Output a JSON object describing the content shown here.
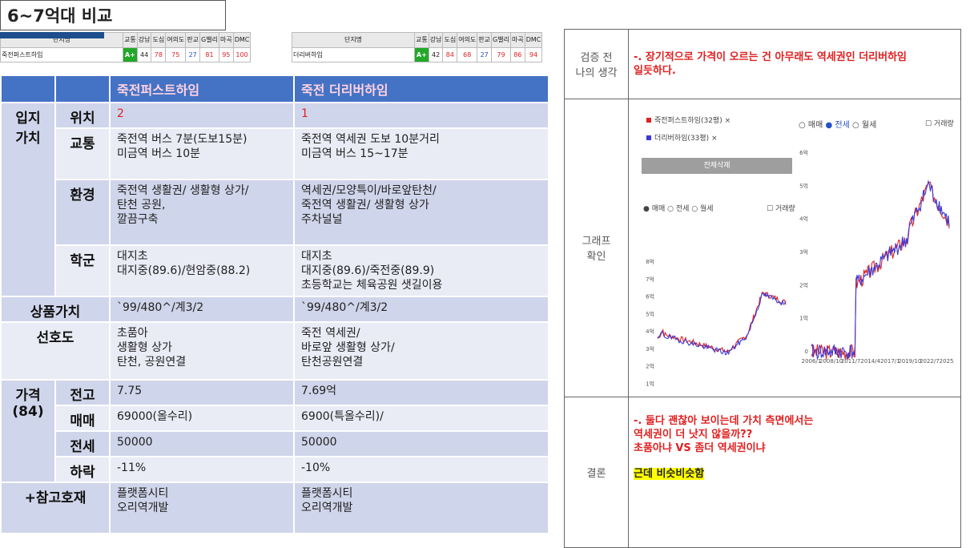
{
  "page_title": "6~7억대 비교",
  "strip": {
    "headers": [
      "단지명",
      "교통",
      "강남",
      "도심",
      "여의도",
      "판교",
      "G밸리",
      "마곡",
      "DMC"
    ],
    "left": {
      "name": "죽전퍼스트하임",
      "grade": "A+",
      "nums": [
        "44",
        "78",
        "75",
        "27",
        "81",
        "95",
        "100"
      ]
    },
    "right": {
      "name": "더리버하임",
      "grade": "A+",
      "nums": [
        "42",
        "84",
        "68",
        "27",
        "79",
        "86",
        "94"
      ]
    }
  },
  "table": {
    "col1": "죽전퍼스트하임",
    "col2": "죽전 더리버하임",
    "rows": {
      "location_cat": "입지\n가치",
      "pos_label": "위치",
      "pos_1": "2",
      "pos_2": "1",
      "traffic_label": "교통",
      "traffic_1": "죽전역 버스 7분(도보15분)\n미금역 버스 10분",
      "traffic_2": "죽전역 역세권 도보 10분거리\n미금역 버스 15~17분",
      "env_label": "환경",
      "env_1": "죽전역 생활권/ 생활형 상가/\n탄천 공원,\n깔끔구축",
      "env_2": "역세권/모양특이/바로앞탄천/\n죽전역 생활권/ 생활형 상가\n주차널널",
      "school_label": "학군",
      "school_1": "대지초\n대지중(89.6)/현암중(88.2)",
      "school_2": "대지초\n대지중(89.6)/죽전중(89.9)\n초등학교는 체육공원 샛길이용",
      "product_label": "상품가치",
      "product_1": "`99/480^/계3/2",
      "product_2": "`99/480^/계3/2",
      "pref_label": "선호도",
      "pref_1": "초품아\n생활형 상가\n탄천, 공원연결",
      "pref_2": "죽전 역세권/\n바로앞 생활형 상가/\n탄천공원연결",
      "price_cat": "가격\n(84)",
      "peak_label": "전고",
      "peak_1": "7.75",
      "peak_2": "7.69억",
      "sale_label": "매매",
      "sale_1": "69000(올수리)",
      "sale_2": "6900(특올수리)/",
      "jeonse_label": "전세",
      "jeonse_1": "50000",
      "jeonse_2": "50000",
      "drop_label": "하락",
      "drop_1": "-11%",
      "drop_2": "-10%",
      "ref_label": "+참고호재",
      "ref_1": "플랫폼시티\n오리역개발",
      "ref_2": "플랫폼시티\n오리역개발"
    }
  },
  "right": {
    "verify_label": "검증 전\n나의 생각",
    "verify_text": "-. 장기적으로 가격이 오르는 건 아무래도 역세권인 더리버하임\n일듯하다.",
    "graph_label": "그래프\n확인",
    "conclusion_label": "결론",
    "conclusion_text": "-. 둘다 괜찮아 보이는데 가치 측면에서는\n역세권이 더 낫지 않을까??\n초품아냐 VS 좀더 역세권이냐",
    "conclusion_highlight": "근데 비슷비슷함"
  },
  "graph": {
    "legend1": "죽전퍼스트하임(32평) ×",
    "legend2": "더리버하임(33평) ×",
    "reset_btn": "전체삭제",
    "radio_sale": "매매",
    "radio_jeonse": "전세",
    "radio_monthly": "월세",
    "trade_vol": "거래량",
    "left_yticks": [
      "8억",
      "7억",
      "6억",
      "5억",
      "4억",
      "3억",
      "2억",
      "1억",
      "0"
    ],
    "left_xticks": [
      "2006/1",
      "2008/10",
      "2011/7",
      "2014/4",
      "2017/1",
      "2019/10",
      "2022/7",
      "2025/4"
    ],
    "right_yticks": [
      "6억",
      "5억",
      "4억",
      "3억",
      "2억",
      "1억",
      "0"
    ],
    "right_xticks": [
      "2006/1",
      "2008/10",
      "2011/7",
      "2014/4",
      "2017/1",
      "2019/10",
      "2022/7",
      "2025/4"
    ],
    "colors": {
      "series1": "#e02020",
      "series2": "#3a3ad8"
    }
  }
}
